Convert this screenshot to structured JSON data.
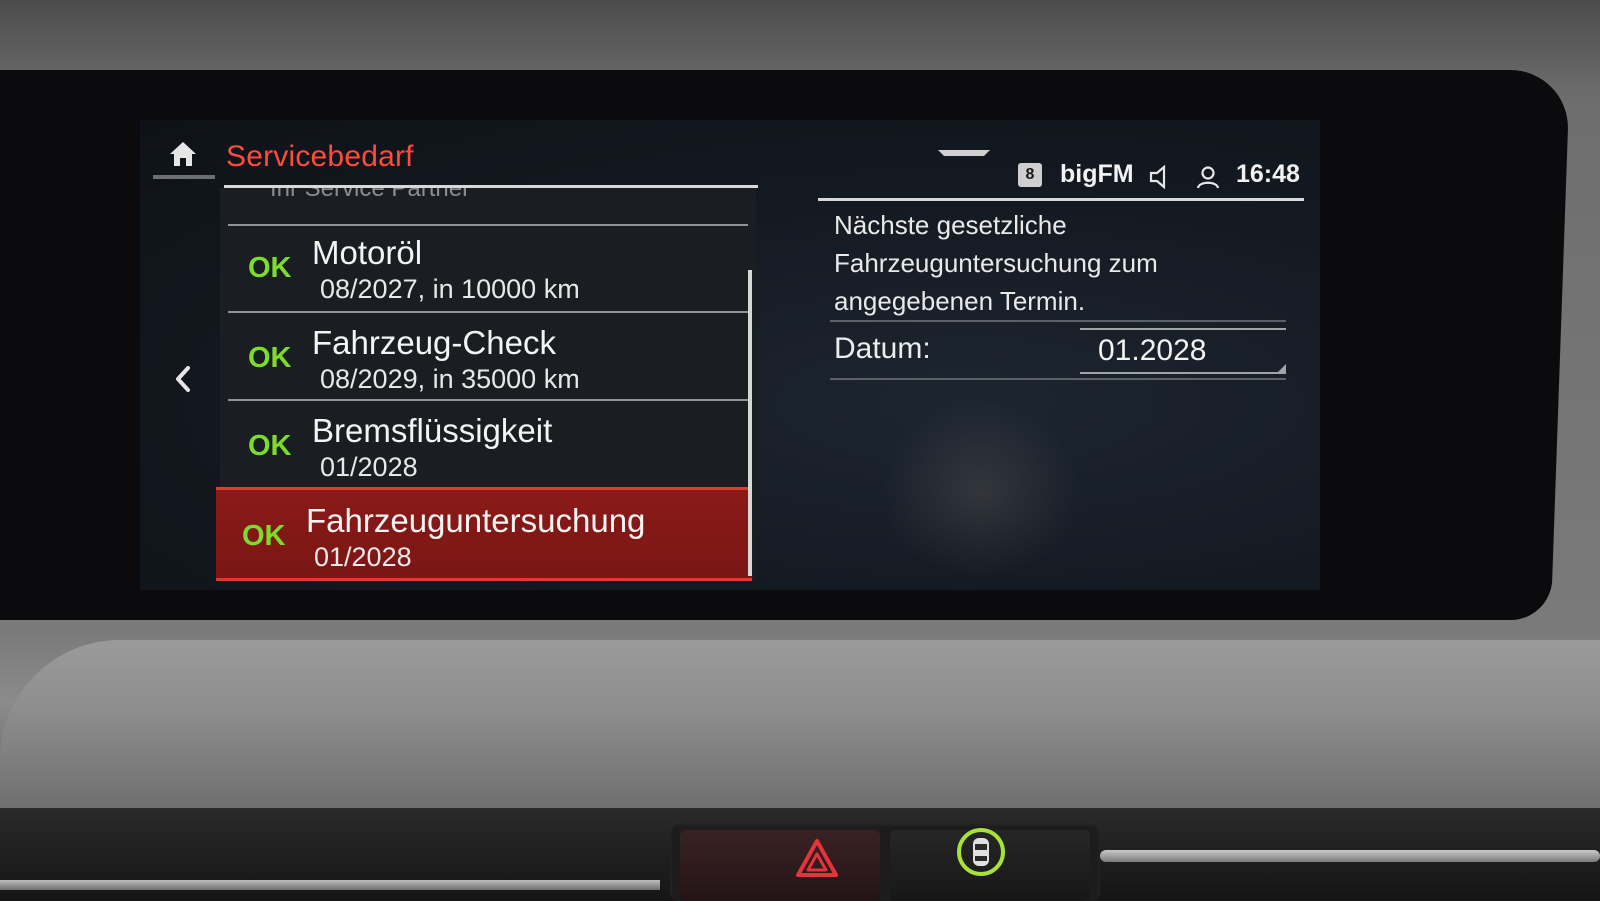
{
  "header": {
    "title": "Servicebedarf",
    "preset_number": "8",
    "station": "bigFM",
    "time": "16:48"
  },
  "list": {
    "partial_item": "Ihr Service Partner",
    "items": [
      {
        "status": "OK",
        "title": "Motoröl",
        "detail": "08/2027, in 10000 km",
        "selected": false
      },
      {
        "status": "OK",
        "title": "Fahrzeug-Check",
        "detail": "08/2029, in 35000 km",
        "selected": false
      },
      {
        "status": "OK",
        "title": "Bremsflüssigkeit",
        "detail": "01/2028",
        "selected": false
      },
      {
        "status": "OK",
        "title": "Fahrzeuguntersuchung",
        "detail": "01/2028",
        "selected": true
      }
    ]
  },
  "detail": {
    "description_lines": [
      "Nächste gesetzliche",
      "Fahrzeuguntersuchung zum",
      "angegebenen Termin."
    ],
    "date_label": "Datum:",
    "date_value": "01.2028"
  },
  "icons": {
    "home": "home-icon",
    "back": "chevron-left-icon",
    "speaker": "speaker-icon",
    "user": "user-icon",
    "menu": "menu-handle-icon",
    "hazard": "hazard-warning-icon",
    "parking": "park-distance-control-icon"
  },
  "colors": {
    "title_red": "#ff4a3d",
    "ok_green": "#7bdc2c",
    "selected_bg": "#8a1a18",
    "selected_border": "#e23a2e"
  }
}
